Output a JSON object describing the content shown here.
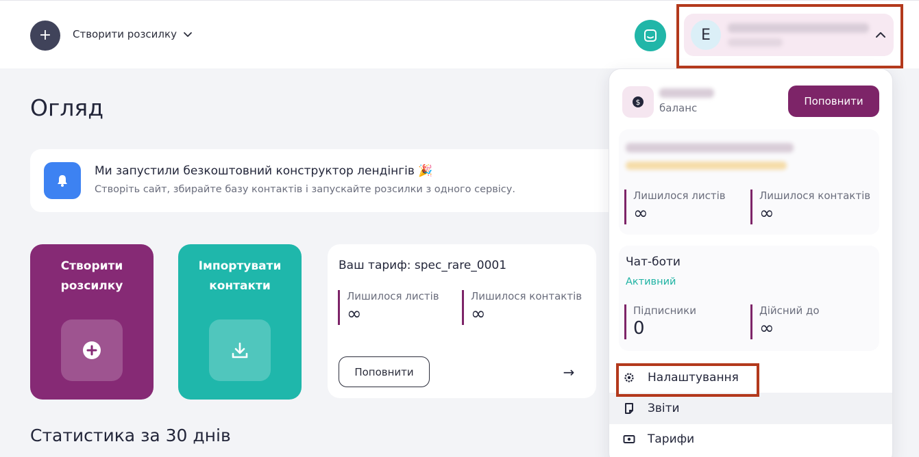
{
  "header": {
    "create_icon": "plus-icon",
    "create_label": "Створити розсилку",
    "help_icon": "chat-support-icon",
    "user": {
      "avatar_letter": "E",
      "expand_icon": "chevron-up-icon"
    }
  },
  "main": {
    "title": "Огляд",
    "banner": {
      "icon": "bell-icon",
      "title": "Ми запустили безкоштовний конструктор лендінгів 🎉",
      "subtitle": "Створіть сайт, збирайте базу контактів і запускайте розсилки з одного сервісу."
    },
    "tiles": [
      {
        "label": "Створити розсилку",
        "icon": "plus-circle-icon",
        "color": "#862a75"
      },
      {
        "label": "Імпортувати контакти",
        "icon": "download-icon",
        "color": "#1fb7ab"
      }
    ],
    "tariff": {
      "title": "Ваш тариф: spec_rare_0001",
      "letters_label": "Лишилося листів",
      "letters_value": "∞",
      "contacts_label": "Лишилося контактів",
      "contacts_value": "∞",
      "topup_label": "Поповнити",
      "arrow_icon": "arrow-right-icon"
    },
    "stats_title": "Статистика за 30 днів"
  },
  "dropdown": {
    "balance_icon": "dollar-coin-icon",
    "balance_label": "баланс",
    "topup_label": "Поповнити",
    "plan": {
      "letters_label": "Лишилося листів",
      "letters_value": "∞",
      "contacts_label": "Лишилося контактів",
      "contacts_value": "∞"
    },
    "chatbots": {
      "title": "Чат-боти",
      "status": "Активний",
      "subscribers_label": "Підписники",
      "subscribers_value": "0",
      "valid_until_label": "Дійсний до",
      "valid_until_value": "∞"
    },
    "menu": [
      {
        "label": "Налаштування",
        "icon": "gear-icon"
      },
      {
        "label": "Звіти",
        "icon": "report-icon"
      },
      {
        "label": "Тарифи",
        "icon": "money-icon"
      }
    ]
  },
  "colors": {
    "brand_purple": "#7d2468",
    "brand_teal": "#1fb7ab",
    "highlight": "#b3391c"
  }
}
